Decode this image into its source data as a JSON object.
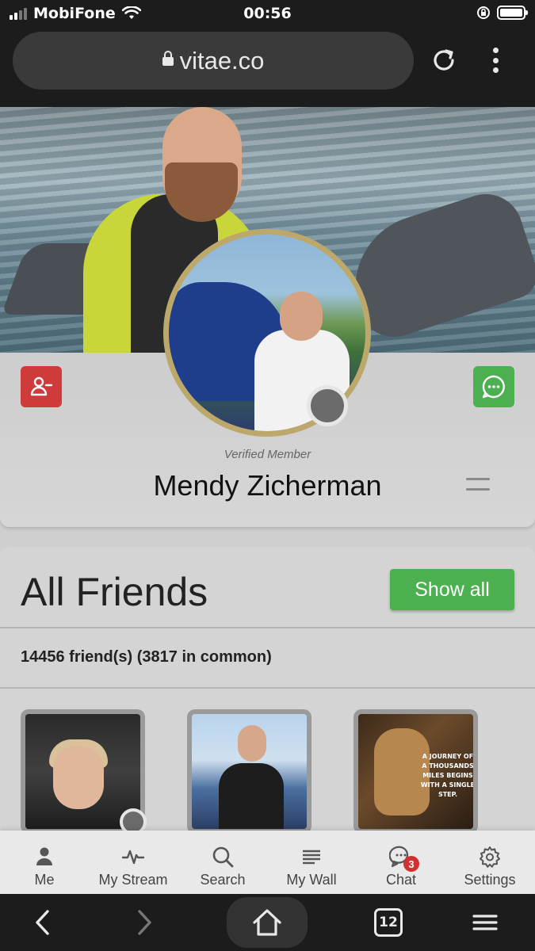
{
  "status_bar": {
    "carrier": "MobiFone",
    "time": "00:56"
  },
  "browser": {
    "url": "vitae.co",
    "tab_count": "12"
  },
  "profile": {
    "verified_label": "Verified Member",
    "name": "Mendy Zicherman"
  },
  "friends": {
    "title": "All Friends",
    "show_all_label": "Show all",
    "count_text": "14456 friend(s) (3817 in common)",
    "thumb3_quote": "A JOURNEY OF A THOUSANDS MILES BEGINS WITH A SINGLE STEP."
  },
  "nav": {
    "items": [
      {
        "label": "Me",
        "icon": "person-icon"
      },
      {
        "label": "My Stream",
        "icon": "pulse-icon"
      },
      {
        "label": "Search",
        "icon": "search-icon"
      },
      {
        "label": "My Wall",
        "icon": "list-icon"
      },
      {
        "label": "Chat",
        "icon": "chat-icon"
      },
      {
        "label": "Settings",
        "icon": "gear-icon"
      }
    ],
    "chat_badge": "3"
  },
  "colors": {
    "accent_green": "#4caf50",
    "danger_red": "#cf3b3b",
    "avatar_ring_gold": "#bda86c"
  }
}
